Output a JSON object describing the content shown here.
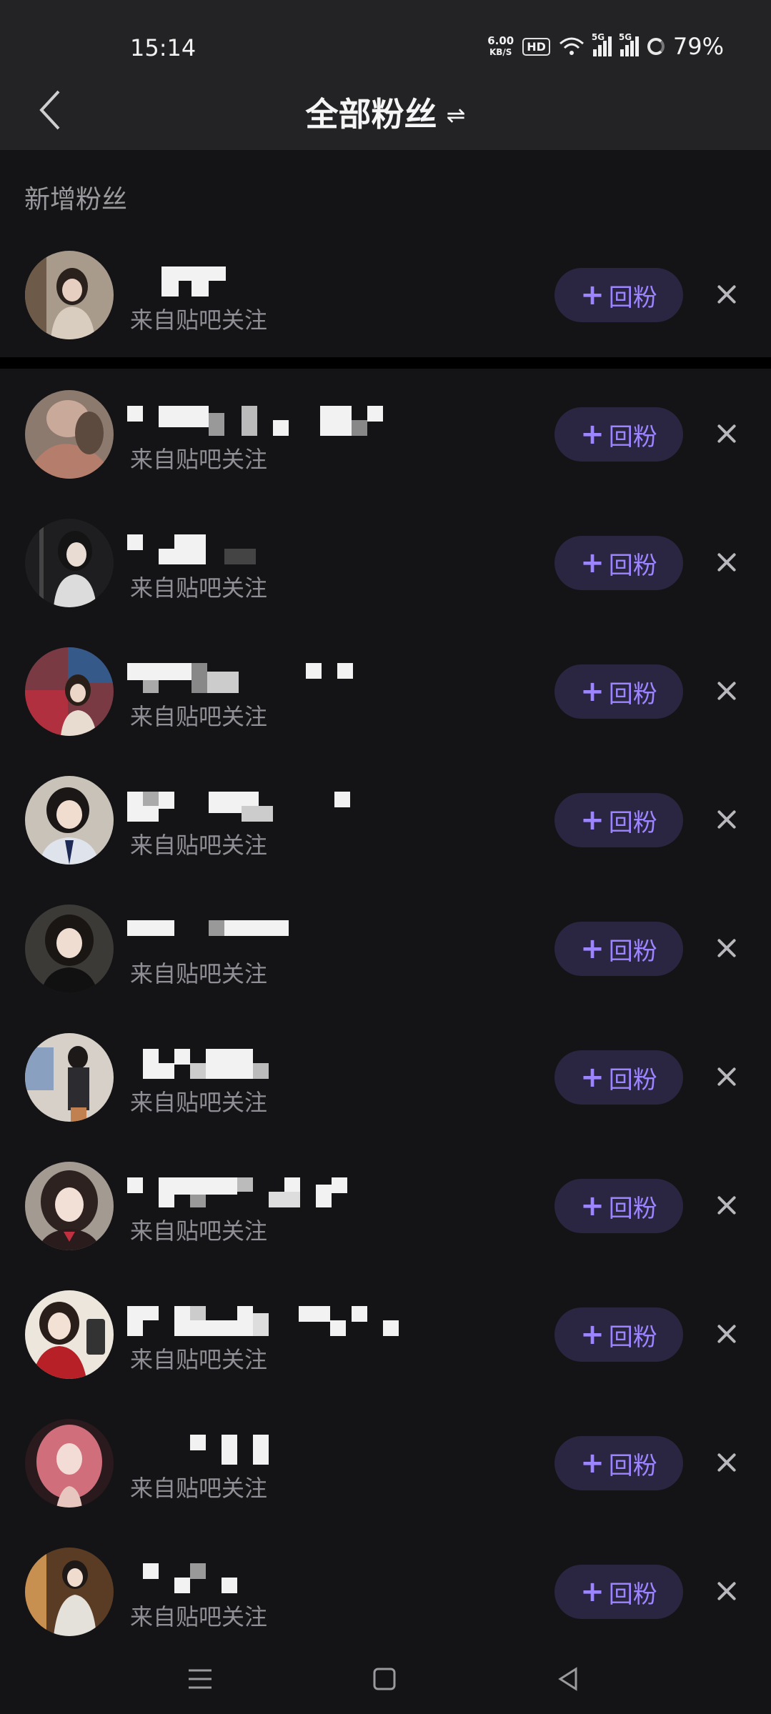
{
  "status": {
    "time": "15:14",
    "speed_value": "6.00",
    "speed_unit": "KB/S",
    "hd": "HD",
    "net1": "5G",
    "net2": "5G",
    "battery": "79%"
  },
  "header": {
    "title": "全部粉丝",
    "swap_icon": "⇌"
  },
  "section": {
    "new_fans": "新增粉丝"
  },
  "fans": [
    {
      "source": "来自贴吧关注",
      "button": "回粉"
    },
    {
      "source": "来自贴吧关注",
      "button": "回粉"
    },
    {
      "source": "来自贴吧关注",
      "button": "回粉"
    },
    {
      "source": "来自贴吧关注",
      "button": "回粉"
    },
    {
      "source": "来自贴吧关注",
      "button": "回粉"
    },
    {
      "source": "来自贴吧关注",
      "button": "回粉"
    },
    {
      "source": "来自贴吧关注",
      "button": "回粉"
    },
    {
      "source": "来自贴吧关注",
      "button": "回粉"
    },
    {
      "source": "来自贴吧关注",
      "button": "回粉"
    },
    {
      "source": "来自贴吧关注",
      "button": "回粉"
    },
    {
      "source": "来自贴吧关注",
      "button": "回粉"
    }
  ],
  "icons": {
    "back": "chevron-left-icon",
    "close": "close-icon",
    "plus": "plus-icon",
    "nav_menu": "menu-icon",
    "nav_home": "square-icon",
    "nav_back": "triangle-back-icon"
  },
  "colors": {
    "background": "#141416",
    "header": "#232325",
    "accent": "#9d85ff",
    "button_bg": "#2a2540"
  }
}
